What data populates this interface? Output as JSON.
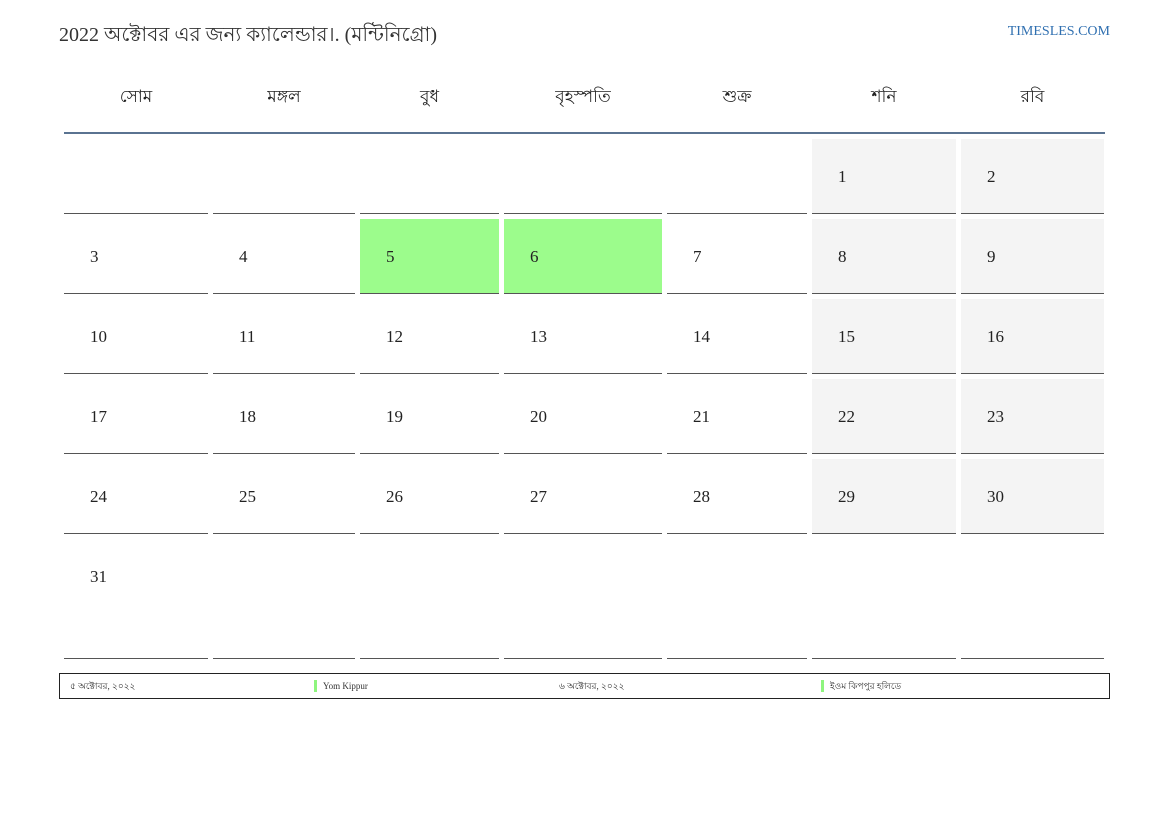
{
  "header": {
    "title": "2022 অক্টোবর এর জন্য ক্যালেন্ডার।. (মন্টিনিগ্রো)",
    "site": "TIMESLES.COM"
  },
  "calendar": {
    "weekdays": [
      "সোম",
      "মঙ্গল",
      "বুধ",
      "বৃহস্পতি",
      "শুক্র",
      "শনি",
      "রবি"
    ],
    "weeks": [
      [
        "",
        "",
        "",
        "",
        "",
        "1",
        "2"
      ],
      [
        "3",
        "4",
        "5",
        "6",
        "7",
        "8",
        "9"
      ],
      [
        "10",
        "11",
        "12",
        "13",
        "14",
        "15",
        "16"
      ],
      [
        "17",
        "18",
        "19",
        "20",
        "21",
        "22",
        "23"
      ],
      [
        "24",
        "25",
        "26",
        "27",
        "28",
        "29",
        "30"
      ],
      [
        "31",
        "",
        "",
        "",
        "",
        "",
        ""
      ]
    ],
    "highlighted_days": [
      "5",
      "6"
    ]
  },
  "colors": {
    "holiday": "#9cfc8c",
    "weekend": "#f4f4f4",
    "accent": "#2f6fb0",
    "header_rule": "#5a7391"
  },
  "legend": {
    "items": [
      {
        "date": "৫ অক্টোবর, ২০২২",
        "name": "Yom Kippur"
      },
      {
        "date": "৬ অক্টোবর, ২০২২",
        "name": "ইওম কিপপুর হলিডে"
      }
    ]
  }
}
